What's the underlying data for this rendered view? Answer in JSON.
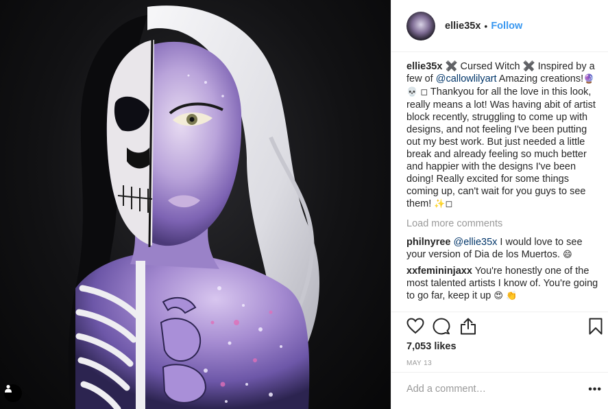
{
  "post": {
    "username": "ellie35x",
    "dot": "•",
    "follow_label": "Follow",
    "caption": {
      "username": "ellie35x",
      "part1": " ✖️ Cursed Witch ✖️ Inspired by a few of ",
      "mention": "@callowlilyart",
      "part2": " Amazing creations!",
      "emojis1": "🔮 💀 ◻",
      "part3": " Thankyou for all the love in this look, really means a lot! Was having abit of artist block recently, struggling to come up with designs, and not feeling I've been putting out my best work. But just needed a little break and already feeling so much better and happier with the designs I've been doing! Really excited for some things coming up, can't wait for you guys to see them!",
      "emojis2": "✨◻"
    },
    "load_more": "Load more comments",
    "comments": [
      {
        "username": "philnyree",
        "mention": "@ellie35x",
        "text": " I would love to see your version of Dia de los Muertos. ",
        "emoji": "😄"
      },
      {
        "username": "xxfemininjaxx",
        "text": " You're honestly one of the most talented artists I know of. You're going to go far, keep it up ",
        "emoji": "😍 👏"
      }
    ],
    "likes": "7,053 likes",
    "date": "MAY 13",
    "add_comment_placeholder": "Add a comment…",
    "more_label": "•••"
  },
  "icons": {
    "like": "heart-icon",
    "comment": "comment-icon",
    "share": "share-icon",
    "save": "bookmark-icon",
    "tag": "person-tag-icon"
  },
  "colors": {
    "link_blue": "#3897f0",
    "mention_blue": "#003569",
    "muted_gray": "#999999",
    "text": "#262626"
  }
}
